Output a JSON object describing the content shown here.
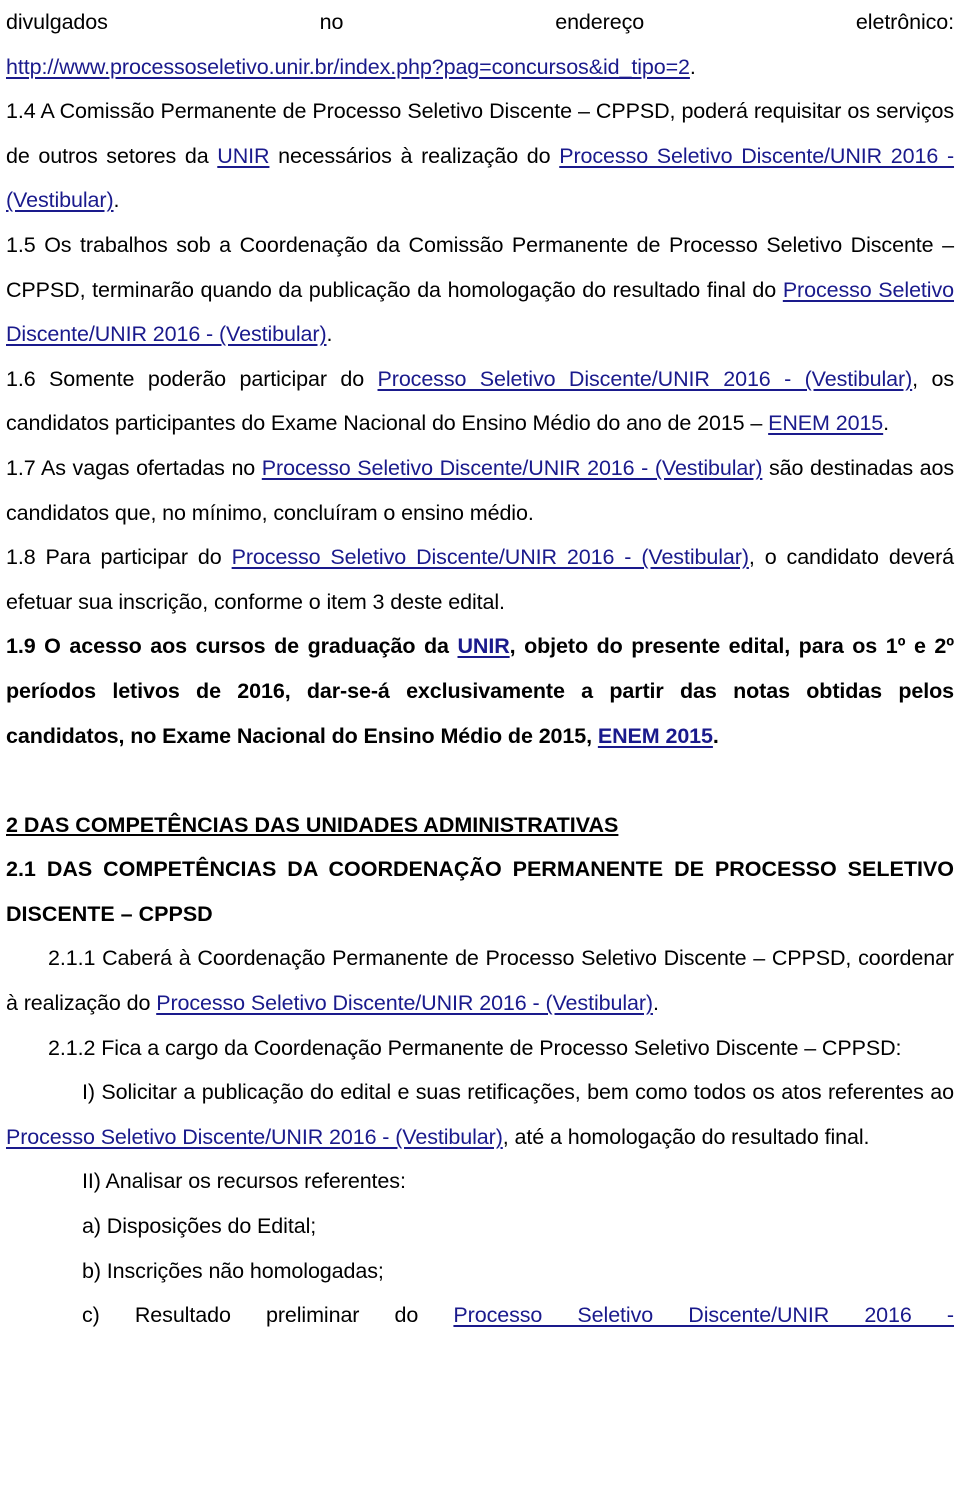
{
  "document": {
    "title": "Edital — Processo Seletivo Discente/UNIR 2016 - (Vestibular)",
    "link_color": "#1a1a8c",
    "text_color": "#000000",
    "background_color": "#ffffff"
  },
  "blocks": {
    "line_continuation": {
      "w1": "divulgados",
      "w2": "no",
      "w3": "endereço",
      "w4": "eletrônico:"
    },
    "url_line": {
      "url": "http://www.processoseletivo.unir.br/index.php?pag=concursos&id_tipo=2",
      "period": "."
    },
    "item_1_4": {
      "text_a": "1.4 A Comissão Permanente de Processo Seletivo Discente – CPPSD, poderá requisitar os serviços de outros setores da ",
      "link_unir": "UNIR",
      "text_b": " necessários à realização do ",
      "link_processo": "Processo Seletivo Discente/UNIR 2016 - (Vestibular)",
      "text_c": "."
    },
    "item_1_5": {
      "text_a": "1.5 Os trabalhos sob a Coordenação da Comissão Permanente de Processo Seletivo Discente – CPPSD, terminarão quando da publicação da homologação do resultado final do ",
      "link_processo": "Processo Seletivo Discente/UNIR 2016 - (Vestibular)",
      "text_b": "."
    },
    "item_1_6": {
      "text_a": "1.6 Somente poderão participar do ",
      "link_processo": "Processo Seletivo Discente/UNIR 2016 - (Vestibular)",
      "text_b": ", os candidatos participantes do Exame Nacional do Ensino Médio do ano de 2015 – ",
      "link_enem": "ENEM 2015",
      "text_c": "."
    },
    "item_1_7": {
      "text_a": "1.7 As vagas ofertadas no ",
      "link_processo": "Processo Seletivo Discente/UNIR 2016 - (Vestibular)",
      "text_b": " são destinadas aos candidatos que, no mínimo, concluíram o ensino médio."
    },
    "item_1_8": {
      "text_a": "1.8 Para participar do ",
      "link_processo": "Processo Seletivo Discente/UNIR 2016 - (Vestibular)",
      "text_b": ", o candidato deverá efetuar sua inscrição, conforme o item 3 deste edital."
    },
    "item_1_9": {
      "text_a": "1.9 O acesso aos cursos de graduação da ",
      "link_unir": "UNIR",
      "text_b": ", objeto do presente edital, para os 1º e 2º períodos letivos de 2016, dar-se-á exclusivamente a partir das notas obtidas pelos candidatos, no Exame Nacional do Ensino Médio de 2015, ",
      "link_enem": "ENEM 2015",
      "text_c": "."
    },
    "heading_2": {
      "text": "2 DAS COMPETÊNCIAS DAS UNIDADES ADMINISTRATIVAS"
    },
    "heading_2_1": {
      "text": "2.1 DAS COMPETÊNCIAS DA COORDENAÇÃO PERMANENTE DE PROCESSO SELETIVO DISCENTE – CPPSD"
    },
    "item_2_1_1": {
      "text_a": "2.1.1 Caberá à Coordenação Permanente de Processo Seletivo Discente – CPPSD, coordenar à realização do ",
      "link_processo": "Processo Seletivo Discente/UNIR 2016 - (Vestibular)",
      "text_b": "."
    },
    "item_2_1_2": {
      "text": "2.1.2 Fica a cargo da Coordenação Permanente de Processo Seletivo Discente – CPPSD:"
    },
    "item_I": {
      "text_a": "I) Solicitar a publicação do edital e suas retificações, bem como todos os atos referentes ao ",
      "link_processo": "Processo Seletivo Discente/UNIR 2016 - (Vestibular)",
      "text_b": ", até a homologação do resultado final."
    },
    "item_II": {
      "text": "II) Analisar os recursos referentes:"
    },
    "item_a": {
      "text": "a) Disposições do Edital;"
    },
    "item_b": {
      "text": "b) Inscrições não homologadas;"
    },
    "item_c": {
      "text_a": "c) Resultado preliminar do ",
      "link_processo": "Processo Seletivo Discente/UNIR 2016 -"
    }
  }
}
